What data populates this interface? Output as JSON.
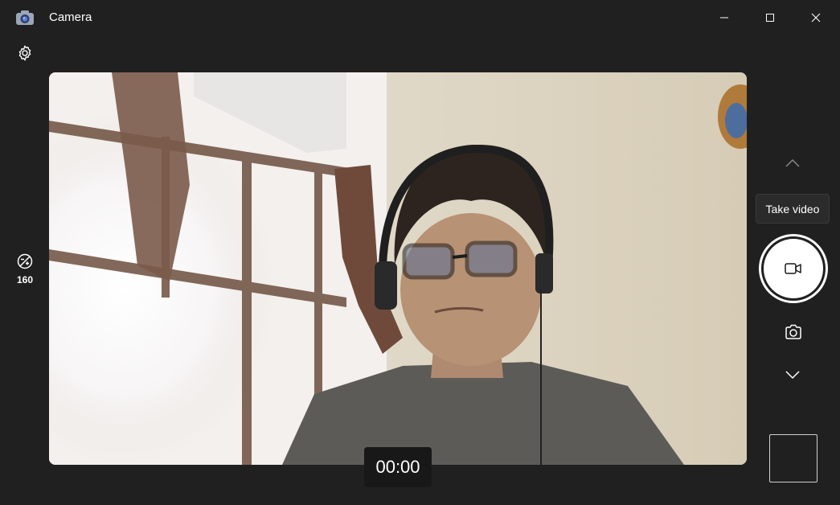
{
  "window": {
    "title": "Camera",
    "icons": {
      "app": "camera-app-icon",
      "minimize": "minimize-icon",
      "maximize": "maximize-icon",
      "close": "close-icon"
    }
  },
  "left_panel": {
    "settings_icon": "gear-icon",
    "exposure": {
      "icon": "exposure-icon",
      "value": "160"
    }
  },
  "preview": {
    "description_colors": {
      "wall": "#d9d1c1",
      "window_glare": "#ffffff",
      "shirt": "#5d5b58"
    }
  },
  "recording": {
    "timer": "00:00"
  },
  "right_panel": {
    "tooltip": "Take video",
    "shutter_mode_icon": "video-camera-icon",
    "photo_mode_icon": "camera-icon",
    "up_icon": "chevron-up-icon",
    "down_icon": "chevron-down-icon"
  },
  "colors": {
    "background": "#202020",
    "accent_white": "#ffffff",
    "tooltip_bg": "#2b2b2b"
  }
}
